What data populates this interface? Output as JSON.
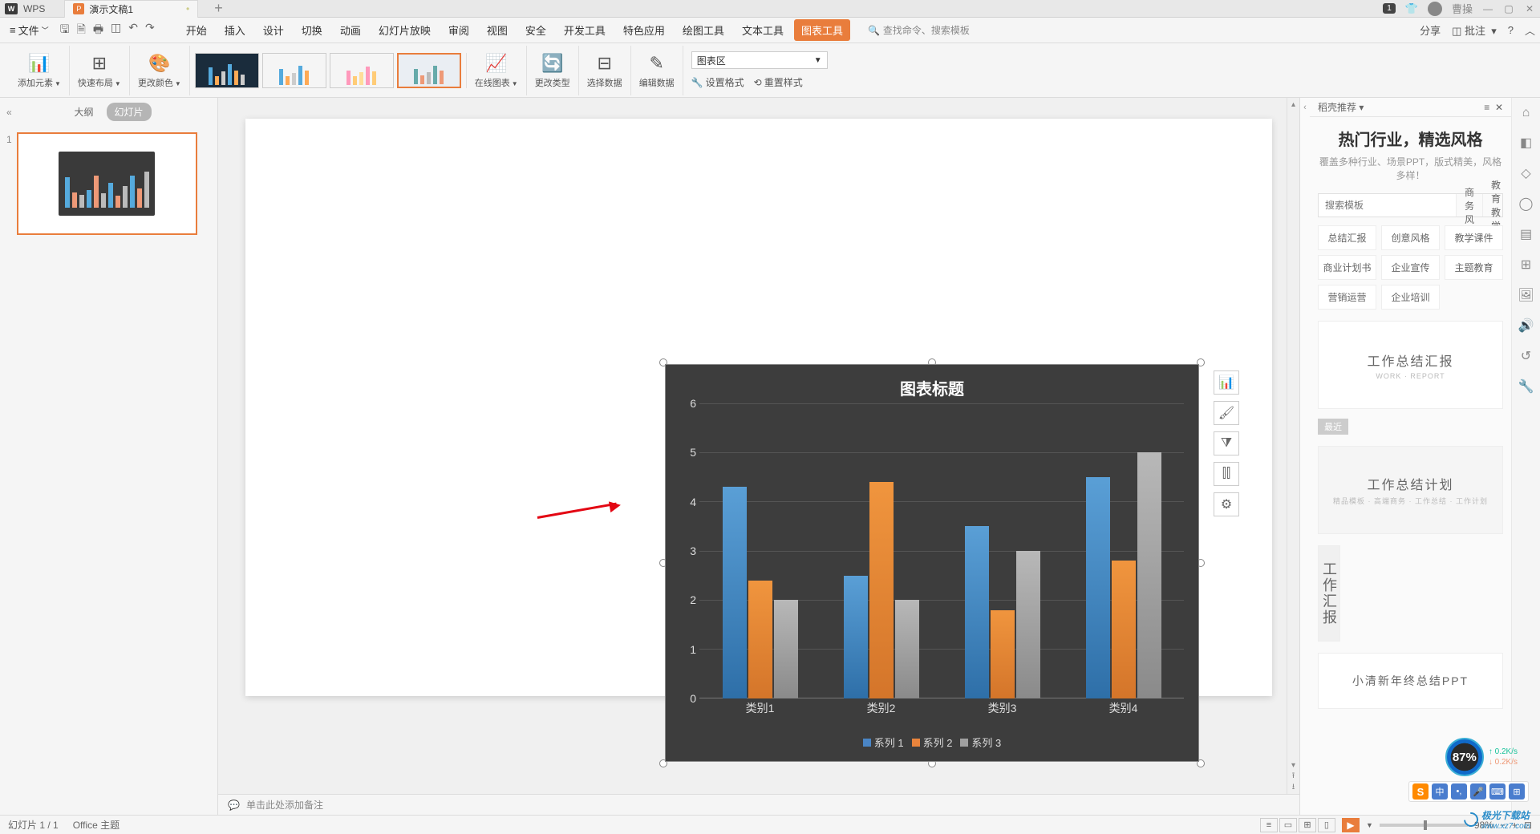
{
  "titlebar": {
    "wps": "WPS",
    "doc_name": "演示文稿1",
    "badge": "1",
    "user": "曹操"
  },
  "menubar": {
    "file": "文件",
    "tabs": [
      "开始",
      "插入",
      "设计",
      "切换",
      "动画",
      "幻灯片放映",
      "审阅",
      "视图",
      "安全",
      "开发工具",
      "特色应用",
      "绘图工具",
      "文本工具",
      "图表工具"
    ],
    "active_tab_index": 13,
    "search_placeholder": "查找命令、搜索模板",
    "share": "分享",
    "annotate": "批注"
  },
  "ribbon": {
    "add_element": "添加元素",
    "quick_layout": "快速布局",
    "change_color": "更改颜色",
    "online_chart": "在线图表",
    "change_type": "更改类型",
    "select_data": "选择数据",
    "edit_data": "编辑数据",
    "chart_area_label": "图表区",
    "set_format": "设置格式",
    "reset_style": "重置样式"
  },
  "slide_panel": {
    "outline": "大纲",
    "slides": "幻灯片",
    "num1": "1"
  },
  "chart_data": {
    "type": "bar",
    "title": "图表标题",
    "categories": [
      "类别1",
      "类别2",
      "类别3",
      "类别4"
    ],
    "series": [
      {
        "name": "系列 1",
        "color": "#4a85c5",
        "values": [
          4.3,
          2.5,
          3.5,
          4.5
        ]
      },
      {
        "name": "系列 2",
        "color": "#e9843c",
        "values": [
          2.4,
          4.4,
          1.8,
          2.8
        ]
      },
      {
        "name": "系列 3",
        "color": "#a0a0a0",
        "values": [
          2.0,
          2.0,
          3.0,
          5.0
        ]
      }
    ],
    "y_ticks": [
      0,
      1,
      2,
      3,
      4,
      5,
      6
    ],
    "ylim": [
      0,
      6
    ]
  },
  "notes": {
    "placeholder": "单击此处添加备注"
  },
  "right_panel": {
    "title": "稻壳推荐",
    "promo_title": "热门行业，精选风格",
    "promo_sub": "覆盖多种行业、场景PPT，版式精美，风格多样！",
    "search_placeholder": "搜索模板",
    "segs": [
      "商务风",
      "教育教学"
    ],
    "tags": [
      "总结汇报",
      "创意风格",
      "教学课件",
      "商业计划书",
      "企业宣传",
      "主题教育",
      "营销运营",
      "企业培训"
    ],
    "recent": "最近",
    "templates": [
      "工作总结汇报",
      "工作总结计划",
      "工作汇报",
      "小清新年终总结PPT"
    ],
    "template_sub": "WORK · REPORT"
  },
  "statusbar": {
    "slide_info": "幻灯片 1 / 1",
    "theme": "Office 主题",
    "zoom": "98%"
  },
  "overlay": {
    "meter": "87%",
    "speed1": "0.2K/s",
    "speed2": "0.2K/s",
    "watermark_text": "极光下载站",
    "watermark_url": "www.xz7.com"
  }
}
